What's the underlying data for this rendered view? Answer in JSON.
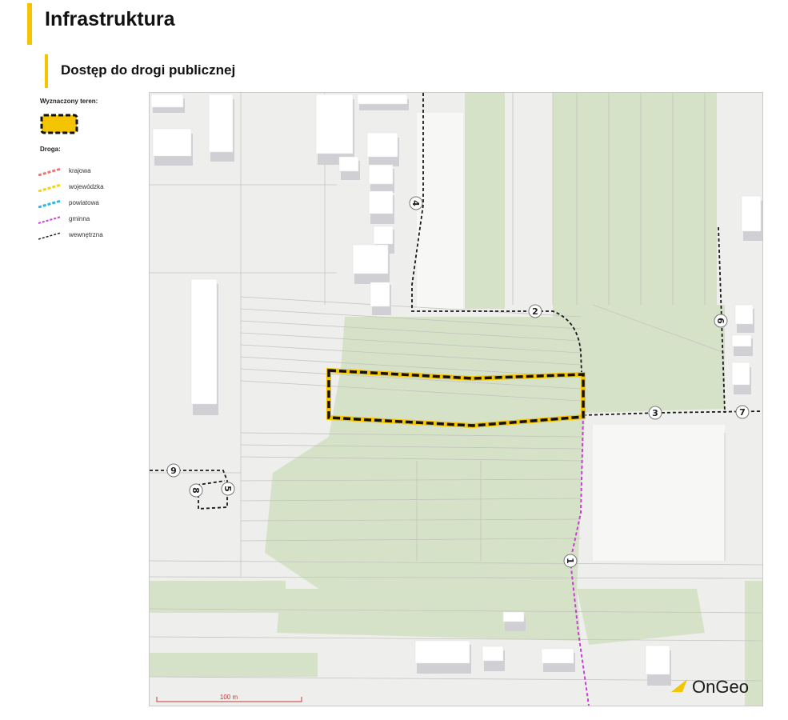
{
  "page": {
    "title": "Infrastruktura",
    "section_title": "Dostęp do drogi publicznej"
  },
  "legend": {
    "area_heading": "Wyznaczony teren:",
    "road_heading": "Droga:",
    "road_types": [
      {
        "label": "krajowa",
        "color": "#e87878"
      },
      {
        "label": "wojewódzka",
        "color": "#f2d21c"
      },
      {
        "label": "powiatowa",
        "color": "#2fb6e6"
      },
      {
        "label": "gminna",
        "color": "#c93fd6"
      },
      {
        "label": "wewnętrzna",
        "color": "#222222"
      }
    ]
  },
  "map": {
    "road_numbers": [
      "1",
      "2",
      "3",
      "4",
      "5",
      "6",
      "7",
      "8",
      "9"
    ],
    "scale_label": "100 m",
    "brand": "OnGeo",
    "colors": {
      "background": "#eeeeec",
      "vegetation": "#d6e2c8",
      "building": "#ffffff",
      "building_shadow": "#cfcfd4",
      "parcel_line": "#bdbdb8",
      "area_outline": "#111111",
      "area_highlight": "#f5c400",
      "brand_accent": "#f5c400"
    }
  }
}
